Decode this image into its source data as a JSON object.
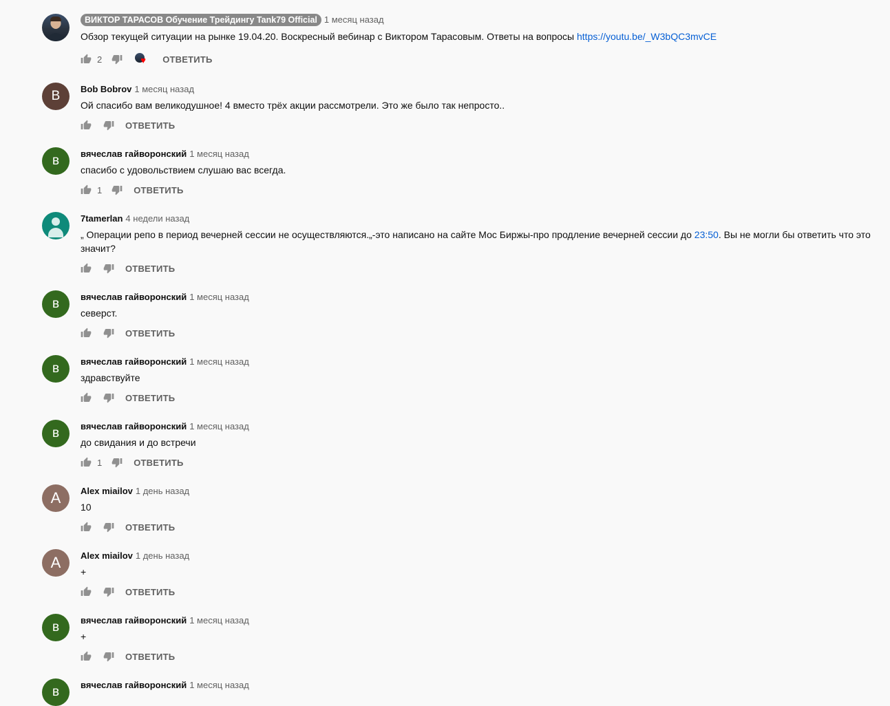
{
  "comments": [
    {
      "author": "ВИКТОР ТАРАСОВ Обучение Трейдингу Tank79 Official",
      "time": "1 месяц назад",
      "text_before": "Обзор текущей ситуации на рынке 19.04.20. Воскресный вебинар с Виктором Тарасовым. Ответы на вопросы ",
      "link": "https://youtu.be/_W3bQC3mvCE",
      "likes": "2",
      "reply": "ОТВЕТИТЬ"
    },
    {
      "author": "Bob Bobrov",
      "avatar_letter": "B",
      "time": "1 месяц назад",
      "text": "Ой спасибо вам великодушное! 4 вместо трёх акции рассмотрели. Это же было так непросто..",
      "reply": "ОТВЕТИТЬ"
    },
    {
      "author": "вячеслав гайворонский",
      "avatar_letter": "в",
      "time": "1 месяц назад",
      "text": "спасибо с удовольствием слушаю вас всегда.",
      "likes": "1",
      "reply": "ОТВЕТИТЬ"
    },
    {
      "author": "7tamerlan",
      "time": "4 недели назад",
      "text_before": "„ Операции репо в период вечерней сессии не осуществляются.„-это написано на сайте Мос Биржы-про продление вечерней сессии до ",
      "link": "23:50",
      "text_after": ". Вы не могли бы ответить что это значит?",
      "reply": "ОТВЕТИТЬ"
    },
    {
      "author": "вячеслав гайворонский",
      "avatar_letter": "в",
      "time": "1 месяц назад",
      "text": "северст.",
      "reply": "ОТВЕТИТЬ"
    },
    {
      "author": "вячеслав гайворонский",
      "avatar_letter": "в",
      "time": "1 месяц назад",
      "text": "здравствуйте",
      "reply": "ОТВЕТИТЬ"
    },
    {
      "author": "вячеслав гайворонский",
      "avatar_letter": "в",
      "time": "1 месяц назад",
      "text": "до свидания и до встречи",
      "likes": "1",
      "reply": "ОТВЕТИТЬ"
    },
    {
      "author": "Alex miailov",
      "avatar_letter": "A",
      "time": "1 день назад",
      "text": "10",
      "reply": "ОТВЕТИТЬ"
    },
    {
      "author": "Alex miailov",
      "avatar_letter": "A",
      "time": "1 день назад",
      "text": "+",
      "reply": "ОТВЕТИТЬ"
    },
    {
      "author": "вячеслав гайворонский",
      "avatar_letter": "в",
      "time": "1 месяц назад",
      "text": "+",
      "reply": "ОТВЕТИТЬ"
    },
    {
      "author": "вячеслав гайворонский",
      "avatar_letter": "в",
      "time": "1 месяц назад"
    }
  ],
  "colors": {
    "background": "#f9f9f9",
    "link": "#065fd4",
    "secondary_text": "#606060",
    "avatar_b_brown": "#5d4037",
    "avatar_v_green": "#33691e",
    "avatar_a_mauve": "#8d6e63",
    "avatar_default_teal": "#0f8a7a",
    "heart": "#ff0000"
  },
  "icons": {
    "like": "thumb-up-icon",
    "dislike": "thumb-down-icon",
    "creator_heart": "creator-heart-icon"
  }
}
